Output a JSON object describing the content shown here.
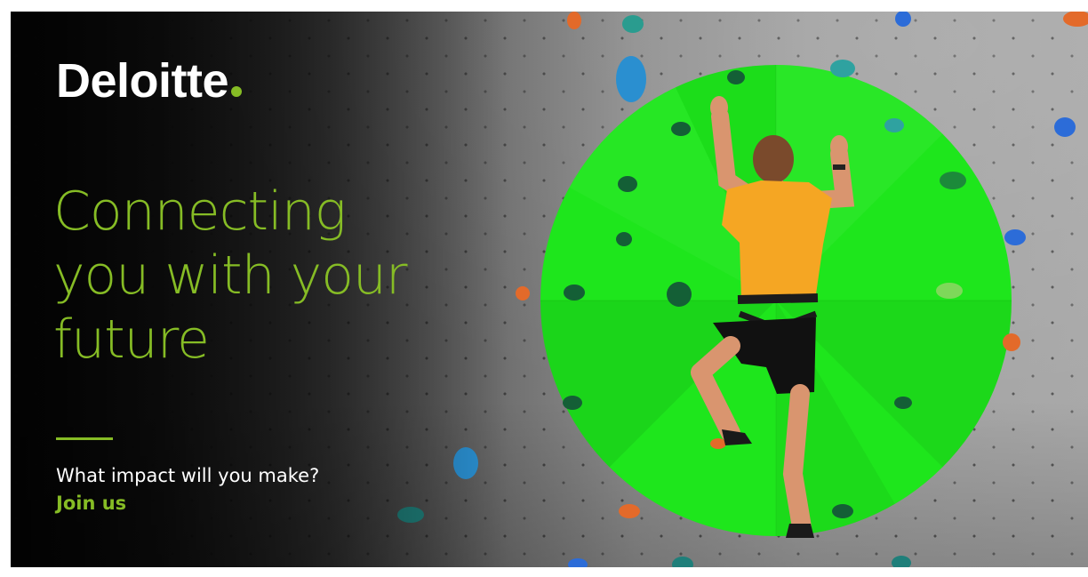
{
  "brand": {
    "name": "Deloitte",
    "accent_color": "#86bc25",
    "circle_color": "#1ee61c",
    "text_color": "#ffffff"
  },
  "headline": {
    "line1": "Connecting",
    "line2": "you with your",
    "line3": "future"
  },
  "tagline": "What impact will you make?",
  "cta": {
    "label": "Join us"
  },
  "image": {
    "subject": "climber-on-wall",
    "icon": "climbing-holds"
  }
}
